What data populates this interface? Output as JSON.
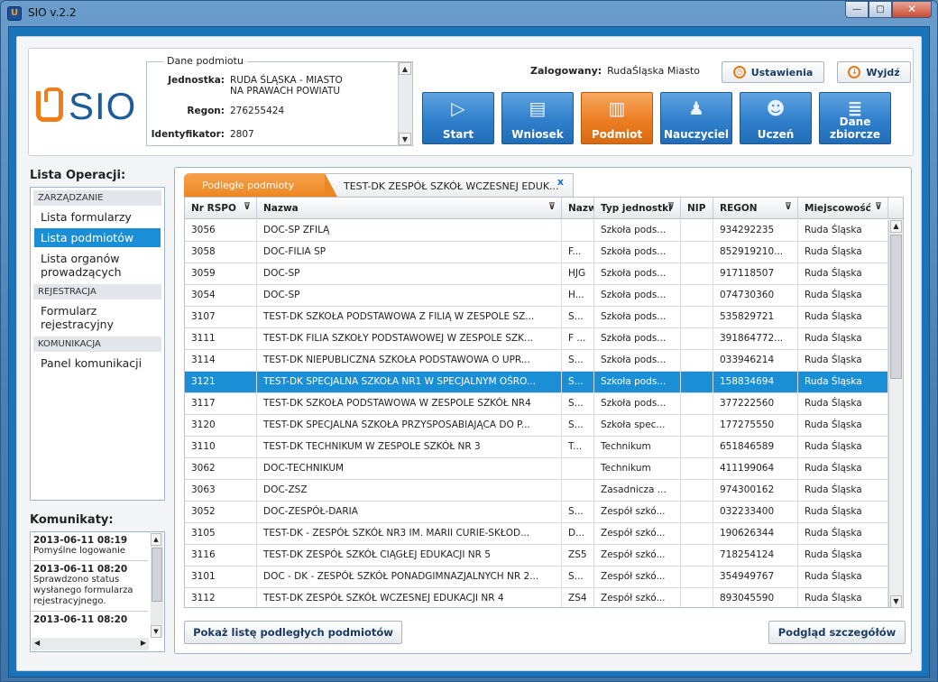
{
  "window": {
    "title": "SIO v.2.2",
    "min": "—",
    "max": "□",
    "close": "✕"
  },
  "logo": {
    "text": "SIO"
  },
  "dane": {
    "legend": "Dane podmiotu",
    "jednostka_label": "Jednostka:",
    "jednostka_value": "RUDA ŚLĄSKA - MIASTO\nNA PRAWACH POWIATU",
    "regon_label": "Regon:",
    "regon_value": "276255424",
    "id_label": "Identyfikator:",
    "id_value": "2807"
  },
  "user": {
    "label": "Zalogowany:",
    "name": "RudaŚląska Miasto"
  },
  "buttons": {
    "settings": "Ustawienia",
    "logout": "Wyjdź"
  },
  "nav": [
    {
      "label": "Start",
      "icon": "▷"
    },
    {
      "label": "Wniosek",
      "icon": "▤"
    },
    {
      "label": "Podmiot",
      "icon": "▥"
    },
    {
      "label": "Nauczyciel",
      "icon": "♟"
    },
    {
      "label": "Uczeń",
      "icon": "☻"
    },
    {
      "label": "Dane zbiorcze",
      "icon": "≣"
    }
  ],
  "sidebar": {
    "title": "Lista Operacji:",
    "sections": [
      {
        "name": "ZARZĄDZANIE",
        "items": [
          "Lista formularzy",
          "Lista podmiotów",
          "Lista organów prowadzących"
        ]
      },
      {
        "name": "REJESTRACJA",
        "items": [
          "Formularz rejestracyjny"
        ]
      },
      {
        "name": "KOMUNIKACJA",
        "items": [
          "Panel komunikacji"
        ]
      }
    ]
  },
  "komunikaty": {
    "title": "Komunikaty:",
    "items": [
      {
        "date": "2013-06-11 08:19",
        "text": "Pomyślne logowanie"
      },
      {
        "date": "2013-06-11 08:20",
        "text": "Sprawdzono status wysłanego formularza rejestracyjnego."
      },
      {
        "date": "2013-06-11 08:20",
        "text": ""
      }
    ]
  },
  "tabs": [
    "Podległe podmioty",
    "TEST-DK ZESPÓŁ SZKÓŁ WCZESNEJ EDUK..."
  ],
  "tab_close": "x",
  "table": {
    "columns": [
      "Nr RSPO",
      "Nazwa",
      "Nazw",
      "Typ jednostki",
      "NIP",
      "REGON",
      "Miejscowość"
    ],
    "filter_icon": "⊽",
    "rows": [
      [
        "3056",
        "DOC-SP ZFILĄ",
        "",
        "Szkoła pods...",
        "",
        "934292235",
        "Ruda Śląska"
      ],
      [
        "3058",
        "DOC-FILIA SP",
        "F...",
        "Szkoła pods...",
        "",
        "852919210...",
        "Ruda Śląska"
      ],
      [
        "3059",
        "DOC-SP",
        "HJG",
        "Szkoła pods...",
        "",
        "917118507",
        "Ruda Śląska"
      ],
      [
        "3054",
        "DOC-SP",
        "H...",
        "Szkoła pods...",
        "",
        "074730360",
        "Ruda Śląska"
      ],
      [
        "3107",
        "TEST-DK SZKOŁA PODSTAWOWA Z FILIĄ W ZESPOLE SZ...",
        "S...",
        "Szkoła pods...",
        "",
        "535829721",
        "Ruda Śląska"
      ],
      [
        "3111",
        "TEST-DK FILIA SZKOŁY PODSTAWOWEJ W ZESPOLE SZK...",
        "F ...",
        "Szkoła pods...",
        "",
        "391864772...",
        "Ruda Śląska"
      ],
      [
        "3114",
        "TEST-DK NIEPUBLICZNA SZKOŁA PODSTAWOWA O UPR...",
        "S...",
        "Szkoła pods...",
        "",
        "033946214",
        "Ruda Śląska"
      ],
      [
        "3121",
        "TEST-DK SPECJALNA SZKOŁA NR1 W SPECJALNYM OŚRO...",
        "S...",
        "Szkoła pods...",
        "",
        "158834694",
        "Ruda Śląska"
      ],
      [
        "3117",
        "TEST-DK SZKOŁA PODSTAWOWA W ZESPOLE SZKÓŁ NR4",
        "S...",
        "Szkoła pods...",
        "",
        "377222560",
        "Ruda Śląska"
      ],
      [
        "3120",
        "TEST-DK SPECJALNA SZKOŁA PRZYSPOSABIAJĄCA DO P...",
        "S...",
        "Szkoła spec...",
        "",
        "177275550",
        "Ruda Śląska"
      ],
      [
        "3110",
        "TEST-DK TECHNIKUM W ZESPOLE SZKÓŁ NR 3",
        "T...",
        "Technikum",
        "",
        "651846589",
        "Ruda Śląska"
      ],
      [
        "3062",
        "DOC-TECHNIKUM",
        "",
        "Technikum",
        "",
        "411199064",
        "Ruda Śląska"
      ],
      [
        "3063",
        "DOC-ZSZ",
        "",
        "Zasadnicza ...",
        "",
        "974300162",
        "Ruda Śląska"
      ],
      [
        "3052",
        "DOC-ZESPÓŁ-DARIA",
        "S...",
        "Zespół szkó...",
        "",
        "032233400",
        "Ruda Śląska"
      ],
      [
        "3105",
        "TEST-DK - ZESPÓŁ SZKÓŁ NR3 IM. MARII CURIE-SKŁOD...",
        "D...",
        "Zespół szkó...",
        "",
        "190626344",
        "Ruda Śląska"
      ],
      [
        "3116",
        "TEST-DK ZESPÓŁ SZKÓŁ CIĄGŁEJ EDUKACJI NR 5",
        "ZS5",
        "Zespół szkó...",
        "",
        "718254124",
        "Ruda Śląska"
      ],
      [
        "3101",
        "DOC - DK - ZESPÓŁ SZKÓŁ PONADGIMNAZJALNYCH NR 2...",
        "S...",
        "Zespół szkó...",
        "",
        "354949767",
        "Ruda Śląska"
      ],
      [
        "3112",
        "TEST-DK ZESPÓŁ SZKÓŁ WCZESNEJ EDUKACJI NR 4",
        "ZS4",
        "Zespół szkó...",
        "",
        "893045590",
        "Ruda Śląska"
      ]
    ],
    "selected_row": 7
  },
  "bottom": {
    "left": "Pokaż listę podległych podmiotów",
    "right": "Podgląd szczegółów"
  }
}
